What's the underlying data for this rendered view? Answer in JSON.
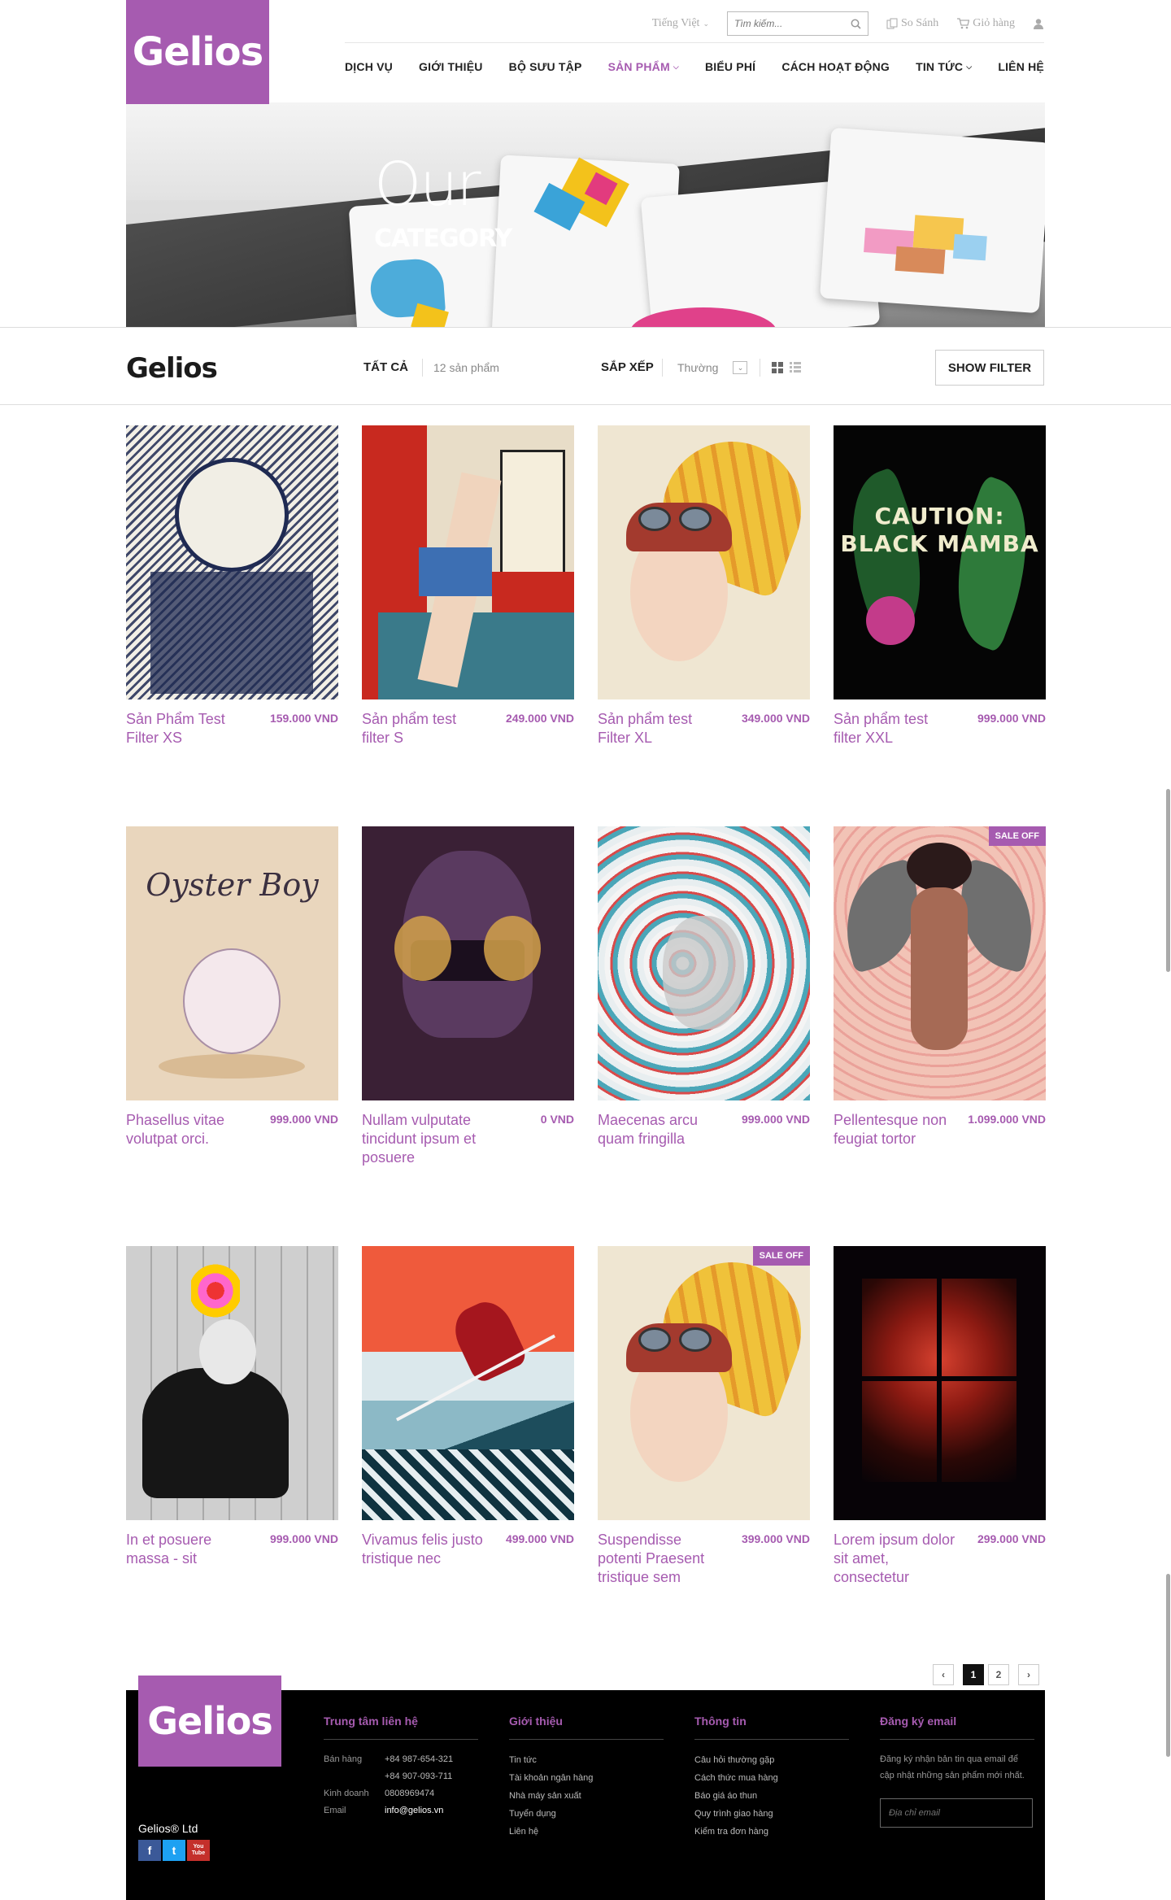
{
  "header": {
    "logo": "Gelios",
    "language": "Tiếng Việt",
    "search_placeholder": "Tìm kiếm...",
    "compare": "So Sánh",
    "cart": "Giỏ hàng",
    "nav": [
      {
        "label": "DỊCH VỤ"
      },
      {
        "label": "GIỚI THIỆU"
      },
      {
        "label": "BỘ SƯU TẬP"
      },
      {
        "label": "SẢN PHẨM",
        "active": true,
        "dropdown": true
      },
      {
        "label": "BIỂU PHÍ"
      },
      {
        "label": "CÁCH HOẠT ĐỘNG"
      },
      {
        "label": "TIN TỨC",
        "dropdown": true
      },
      {
        "label": "LIÊN HỆ"
      }
    ]
  },
  "banner": {
    "line1": "Our",
    "line2": "CATEGORY"
  },
  "filter": {
    "brand": "Gelios",
    "all_label": "TẤT CẢ",
    "count": "12 sản phẩm",
    "sort_label": "SẮP XẾP",
    "sort_value": "Thường",
    "show_filter": "SHOW FILTER"
  },
  "products": [
    {
      "name": "Sản Phẩm Test Filter XS",
      "price": "159.000 VND",
      "art": "art-1"
    },
    {
      "name": "Sản phẩm test filter S",
      "price": "249.000 VND",
      "art": "art-2"
    },
    {
      "name": "Sản phẩm test Filter XL",
      "price": "349.000 VND",
      "art": "art-3"
    },
    {
      "name": "Sản phẩm test filter XXL",
      "price": "999.000 VND",
      "art": "art-4",
      "art_text": "CAUTION: BLACK MAMBA"
    },
    {
      "name": "Phasellus vitae volutpat orci.",
      "price": "999.000 VND",
      "art": "art-5",
      "art_text": "Oyster Boy"
    },
    {
      "name": "Nullam vulputate tincidunt ipsum et posuere",
      "price": "0 VND",
      "art": "art-6"
    },
    {
      "name": "Maecenas arcu quam fringilla",
      "price": "999.000 VND",
      "art": "art-7"
    },
    {
      "name": "Pellentesque non feugiat tortor",
      "price": "1.099.000 VND",
      "art": "art-8",
      "sale": "SALE OFF"
    },
    {
      "name": "In et posuere massa - sit",
      "price": "999.000 VND",
      "art": "art-9"
    },
    {
      "name": "Vivamus felis justo tristique nec",
      "price": "499.000 VND",
      "art": "art-10"
    },
    {
      "name": "Suspendisse potenti Praesent tristique sem",
      "price": "399.000 VND",
      "art": "art-3",
      "sale": "SALE OFF"
    },
    {
      "name": "Lorem ipsum dolor sit amet, consectetur",
      "price": "299.000 VND",
      "art": "art-12"
    }
  ],
  "pagination": {
    "pages": [
      "1",
      "2"
    ],
    "current": "1"
  },
  "footer": {
    "logo": "Gelios",
    "company": "Gelios® Ltd",
    "social": [
      "f",
      "t",
      "You Tube"
    ],
    "contact": {
      "title": "Trung tâm liên hệ",
      "rows": [
        {
          "k": "Bán hàng",
          "v": "+84 987-654-321"
        },
        {
          "k": "",
          "v": "+84 907-093-711"
        },
        {
          "k": "Kinh doanh",
          "v": "0808969474"
        },
        {
          "k": "Email",
          "v": "info@gelios.vn"
        }
      ]
    },
    "about": {
      "title": "Giới thiệu",
      "items": [
        "Tin tức",
        "Tài khoản ngân hàng",
        "Nhà máy sản xuất",
        "Tuyển dụng",
        "Liên hệ"
      ]
    },
    "info": {
      "title": "Thông tin",
      "items": [
        "Câu hỏi thường gặp",
        "Cách thức mua hàng",
        "Báo giá áo thun",
        "Quy trình giao hàng",
        "Kiểm tra đơn hàng"
      ]
    },
    "newsletter": {
      "title": "Đăng ký email",
      "text": "Đăng ký nhận bản tin qua email để cập nhật những sản phẩm mới nhất.",
      "placeholder": "Địa chỉ email"
    }
  },
  "colors": {
    "brand": "#a65bb0",
    "footer_bg": "#000000"
  }
}
